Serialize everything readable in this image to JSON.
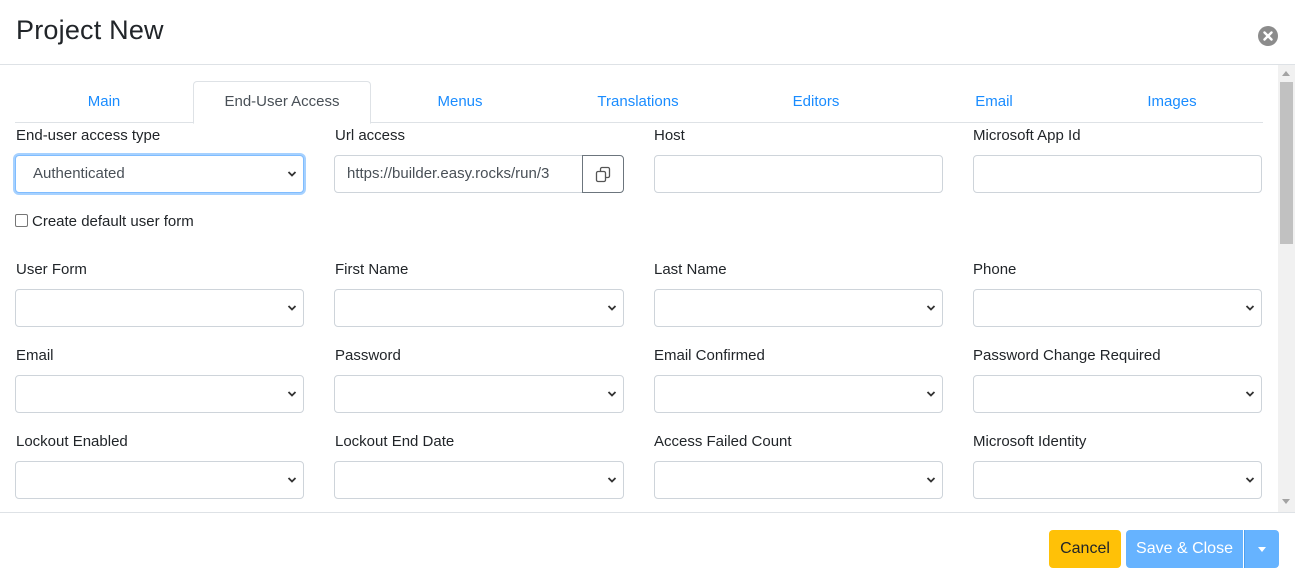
{
  "dialog": {
    "title": "Project New"
  },
  "tabs": [
    {
      "label": "Main",
      "active": false
    },
    {
      "label": "End-User Access",
      "active": true
    },
    {
      "label": "Menus",
      "active": false
    },
    {
      "label": "Translations",
      "active": false
    },
    {
      "label": "Editors",
      "active": false
    },
    {
      "label": "Email",
      "active": false
    },
    {
      "label": "Images",
      "active": false
    }
  ],
  "access": {
    "type_label": "End-user access type",
    "type_value": "Authenticated",
    "url_label": "Url access",
    "url_value": "https://builder.easy.rocks/run/3",
    "host_label": "Host",
    "host_value": "",
    "ms_app_id_label": "Microsoft App Id",
    "ms_app_id_value": "",
    "create_default_label": "Create default user form",
    "create_default_checked": false
  },
  "mappings": {
    "user_form": "User Form",
    "first_name": "First Name",
    "last_name": "Last Name",
    "phone": "Phone",
    "email": "Email",
    "password": "Password",
    "email_confirmed": "Email Confirmed",
    "password_change_required": "Password Change Required",
    "lockout_enabled": "Lockout Enabled",
    "lockout_end_date": "Lockout End Date",
    "access_failed_count": "Access Failed Count",
    "microsoft_identity": "Microsoft Identity"
  },
  "footer": {
    "cancel_label": "Cancel",
    "save_label": "Save & Close"
  },
  "colors": {
    "link": "#1a8cff",
    "cancel": "#ffc107",
    "save": "#66b3ff"
  }
}
